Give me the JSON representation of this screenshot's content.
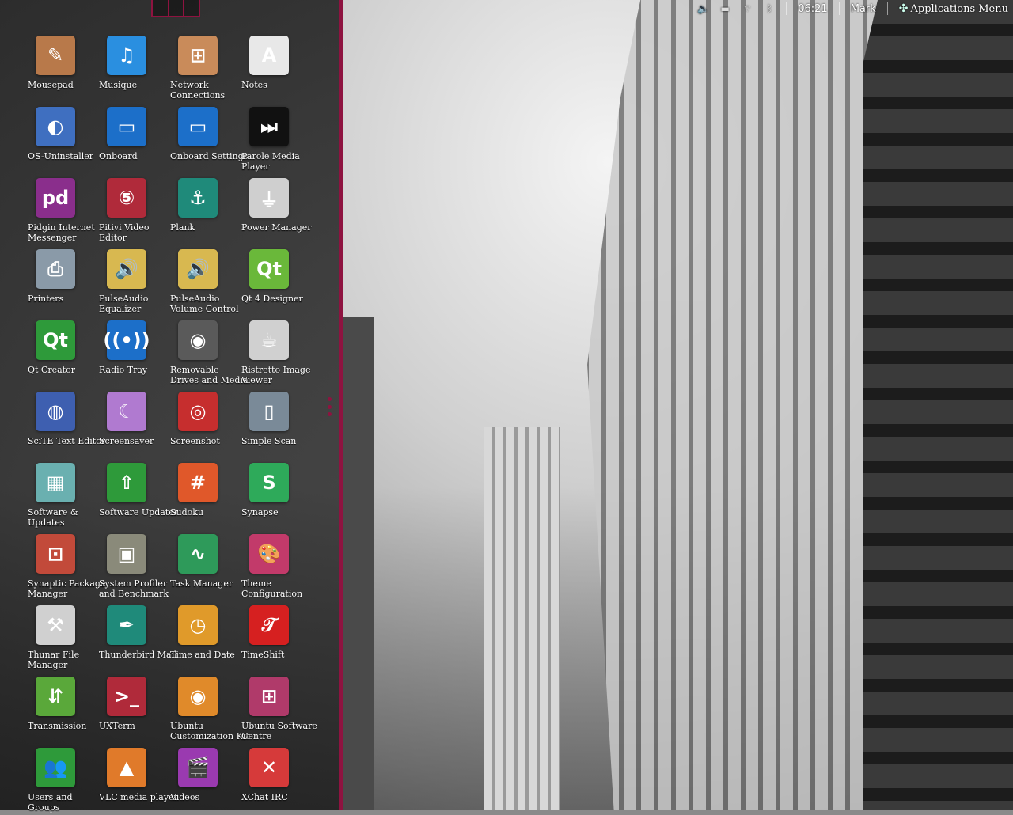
{
  "top_panel": {
    "time": "06:21",
    "user": "Mark",
    "applications_menu": "Applications Menu",
    "icons": [
      "volume-icon",
      "battery-icon",
      "network-icon",
      "bluetooth-icon"
    ]
  },
  "launcher": {
    "accent_color": "#8e1340",
    "apps": [
      {
        "label": "Mousepad",
        "icon": "mousepad-icon",
        "glyph": "✎",
        "color": "#b8794a"
      },
      {
        "label": "Musique",
        "icon": "music-note-icon",
        "glyph": "♫",
        "color": "#2a8fe0"
      },
      {
        "label": "Network Connections",
        "icon": "network-connections-icon",
        "glyph": "⊞",
        "color": "#c98b5a"
      },
      {
        "label": "Notes",
        "icon": "notes-icon",
        "glyph": "A",
        "color": "#e8e8e8"
      },
      {
        "label": "OS-Uninstaller",
        "icon": "os-uninstaller-icon",
        "glyph": "◐",
        "color": "#3f6fc0"
      },
      {
        "label": "Onboard",
        "icon": "onboard-icon",
        "glyph": "▭",
        "color": "#1c6fc9"
      },
      {
        "label": "Onboard Settings",
        "icon": "onboard-settings-icon",
        "glyph": "▭",
        "color": "#1c6fc9"
      },
      {
        "label": "Parole Media Player",
        "icon": "media-player-icon",
        "glyph": "⏭",
        "color": "#111111"
      },
      {
        "label": "Pidgin Internet Messenger",
        "icon": "pidgin-icon",
        "glyph": "pd",
        "color": "#8a2e8c"
      },
      {
        "label": "Pitivi Video Editor",
        "icon": "pitivi-icon",
        "glyph": "⑤",
        "color": "#b02a3a"
      },
      {
        "label": "Plank",
        "icon": "anchor-icon",
        "glyph": "⚓",
        "color": "#1f8a7a"
      },
      {
        "label": "Power Manager",
        "icon": "power-plug-icon",
        "glyph": "⏚",
        "color": "#cfcfcf"
      },
      {
        "label": "Printers",
        "icon": "printer-icon",
        "glyph": "⎙",
        "color": "#8a9aa8"
      },
      {
        "label": "PulseAudio Equalizer",
        "icon": "speaker-icon",
        "glyph": "🔊",
        "color": "#d8b850"
      },
      {
        "label": "PulseAudio Volume Control",
        "icon": "speaker-icon",
        "glyph": "🔊",
        "color": "#d8b850"
      },
      {
        "label": "Qt 4 Designer",
        "icon": "qt-designer-icon",
        "glyph": "Qt",
        "color": "#6ab83a"
      },
      {
        "label": "Qt Creator",
        "icon": "qt-creator-icon",
        "glyph": "Qt",
        "color": "#2e9a3a"
      },
      {
        "label": "Radio Tray",
        "icon": "radio-antenna-icon",
        "glyph": "((•))",
        "color": "#1c6fc9"
      },
      {
        "label": "Removable Drives and Media",
        "icon": "drive-icon",
        "glyph": "◉",
        "color": "#5a5a5a"
      },
      {
        "label": "Ristretto Image Viewer",
        "icon": "coffee-cup-icon",
        "glyph": "☕",
        "color": "#d0d0d0"
      },
      {
        "label": "SciTE Text Editor",
        "icon": "globe-icon",
        "glyph": "◍",
        "color": "#3e5fb0"
      },
      {
        "label": "Screensaver",
        "icon": "screensaver-icon",
        "glyph": "☾",
        "color": "#b07ad0"
      },
      {
        "label": "Screenshot",
        "icon": "screenshot-icon",
        "glyph": "◎",
        "color": "#c62e2e"
      },
      {
        "label": "Simple Scan",
        "icon": "scanner-icon",
        "glyph": "▯",
        "color": "#7a8a98"
      },
      {
        "label": "Software & Updates",
        "icon": "package-box-icon",
        "glyph": "▦",
        "color": "#6ab0b0"
      },
      {
        "label": "Software Updater",
        "icon": "software-updater-icon",
        "glyph": "⇧",
        "color": "#2e9a3a"
      },
      {
        "label": "Sudoku",
        "icon": "sudoku-icon",
        "glyph": "#",
        "color": "#e0582a"
      },
      {
        "label": "Synapse",
        "icon": "synapse-icon",
        "glyph": "S",
        "color": "#2eaa5a"
      },
      {
        "label": "Synaptic Package Manager",
        "icon": "synaptic-icon",
        "glyph": "⊡",
        "color": "#c24a3a"
      },
      {
        "label": "System Profiler and Benchmark",
        "icon": "chip-icon",
        "glyph": "▣",
        "color": "#8a8a7a"
      },
      {
        "label": "Task Manager",
        "icon": "task-manager-icon",
        "glyph": "∿",
        "color": "#2e9a5a"
      },
      {
        "label": "Theme Configuration",
        "icon": "palette-icon",
        "glyph": "🎨",
        "color": "#c23a6a"
      },
      {
        "label": "Thunar File Manager",
        "icon": "thunar-icon",
        "glyph": "⚒",
        "color": "#d0d0d0"
      },
      {
        "label": "Thunderbird Mail",
        "icon": "thunderbird-icon",
        "glyph": "✒",
        "color": "#1f8a7a"
      },
      {
        "label": "Time and Date",
        "icon": "clock-icon",
        "glyph": "◷",
        "color": "#e09a2a"
      },
      {
        "label": "TimeShift",
        "icon": "timeshift-icon",
        "glyph": "𝒯",
        "color": "#d62020"
      },
      {
        "label": "Transmission",
        "icon": "transmission-icon",
        "glyph": "⇵",
        "color": "#5aa83a"
      },
      {
        "label": "UXTerm",
        "icon": "terminal-icon",
        "glyph": ">_",
        "color": "#b02a3a"
      },
      {
        "label": "Ubuntu Customization Kit",
        "icon": "disc-icon",
        "glyph": "◉",
        "color": "#e08a2a"
      },
      {
        "label": "Ubuntu Software Centre",
        "icon": "software-centre-icon",
        "glyph": "⊞",
        "color": "#b03a6a"
      },
      {
        "label": "Users and Groups",
        "icon": "users-icon",
        "glyph": "👥",
        "color": "#2e9a3a"
      },
      {
        "label": "VLC media player",
        "icon": "vlc-cone-icon",
        "glyph": "▲",
        "color": "#e07a2a"
      },
      {
        "label": "Videos",
        "icon": "video-clapper-icon",
        "glyph": "🎬",
        "color": "#9a3ab0"
      },
      {
        "label": "XChat IRC",
        "icon": "xchat-icon",
        "glyph": "✕",
        "color": "#d63a3a"
      }
    ]
  }
}
